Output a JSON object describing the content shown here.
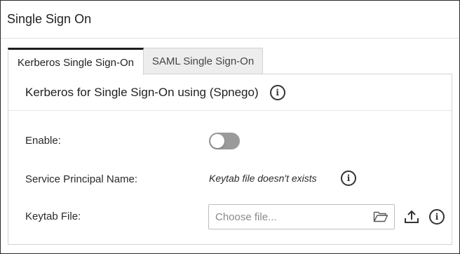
{
  "header": {
    "title": "Single Sign On"
  },
  "tabs": [
    {
      "label": "Kerberos Single Sign-On",
      "active": true
    },
    {
      "label": "SAML Single Sign-On",
      "active": false
    }
  ],
  "panel": {
    "title": "Kerberos for Single Sign-On using (Spnego)",
    "enable_label": "Enable:",
    "enable_value": false,
    "spn_label": "Service Principal Name:",
    "spn_status": "Keytab file doesn't exists",
    "keytab_label": "Keytab File:",
    "keytab_placeholder": "Choose file..."
  },
  "icons": {
    "info": "info-icon",
    "folder": "folder-open-icon",
    "upload": "upload-icon"
  },
  "colors": {
    "toggle_off": "#9a9a9a",
    "active_tab_border": "#1d1d1d",
    "inactive_tab_bg": "#ededed"
  }
}
